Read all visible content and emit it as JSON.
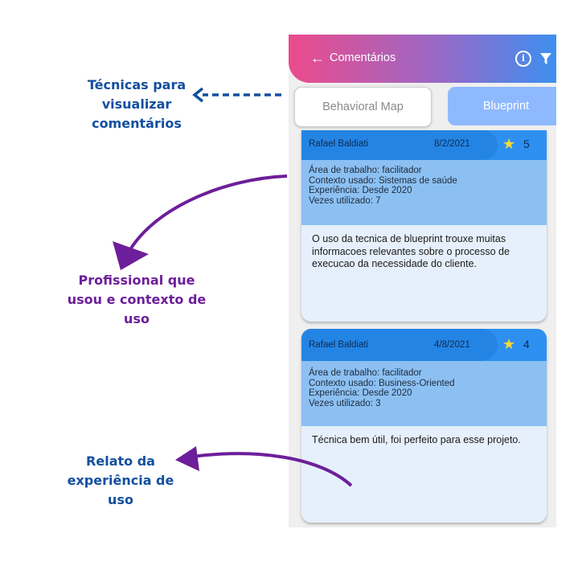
{
  "app": {
    "title": "Comentários",
    "back_icon": "arrow-left-icon",
    "info_icon": "info-icon",
    "filter_icon": "filter-icon"
  },
  "tabs": [
    {
      "label": "Behavioral Map",
      "active": false
    },
    {
      "label": "Blueprint",
      "active": true
    }
  ],
  "comments": [
    {
      "name": "Rafael Baldiati",
      "date": "8/2/2021",
      "rating": "5",
      "context": [
        "Área de trabalho: facilitador",
        "Contexto usado: Sistemas de saúde",
        "Experiência: Desde 2020",
        "Vezes utilizado: 7"
      ],
      "text": "O uso da tecnica de blueprint trouxe muitas informacoes relevantes sobre o processo de execucao da necessidade do cliente."
    },
    {
      "name": "Rafael Baldiati",
      "date": "4/8/2021",
      "rating": "4",
      "context": [
        "Área de trabalho: facilitador",
        "Contexto usado: Business-Oriented",
        "Experiência: Desde 2020",
        "Vezes utilizado: 3"
      ],
      "text": "Técnica bem útil, foi perfeito para esse projeto."
    }
  ],
  "annotations": {
    "tecnicas": [
      "Técnicas para",
      "visualizar",
      "comentários"
    ],
    "profissional": [
      "Profissional que",
      "usou e contexto de",
      "uso"
    ],
    "relato": [
      "Relato da",
      "experiência de",
      "uso"
    ]
  },
  "colors": {
    "annotation_blue": "#124fa0",
    "annotation_purple": "#6d1e9a",
    "card_header": "#2484e4",
    "card_context": "#8cc0f3",
    "card_body": "#e6f0fc"
  }
}
